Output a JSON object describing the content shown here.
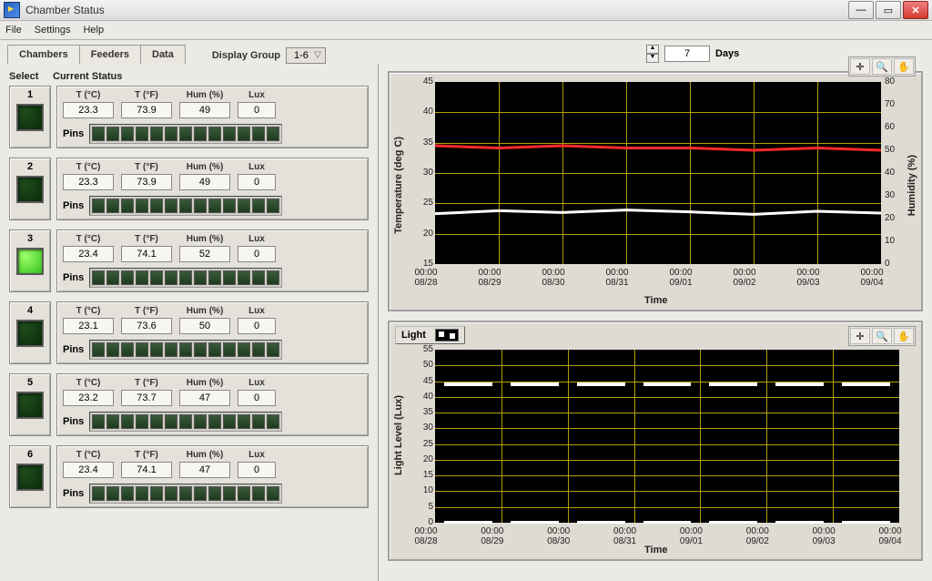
{
  "window": {
    "title": "Chamber Status"
  },
  "menu": {
    "file": "File",
    "settings": "Settings",
    "help": "Help"
  },
  "tabs": {
    "chambers": "Chambers",
    "feeders": "Feeders",
    "data": "Data"
  },
  "display_group": {
    "label": "Display Group",
    "value": "1-6"
  },
  "days": {
    "value": "7",
    "label": "Days"
  },
  "columns": {
    "select": "Select",
    "current": "Current Status",
    "tc": "T (°C)",
    "tf": "T (°F)",
    "hum": "Hum (%)",
    "lux": "Lux",
    "pins": "Pins"
  },
  "chambers": [
    {
      "n": "1",
      "sel": false,
      "tc": "23.3",
      "tf": "73.9",
      "hum": "49",
      "lux": "0"
    },
    {
      "n": "2",
      "sel": false,
      "tc": "23.3",
      "tf": "73.9",
      "hum": "49",
      "lux": "0"
    },
    {
      "n": "3",
      "sel": true,
      "tc": "23.4",
      "tf": "74.1",
      "hum": "52",
      "lux": "0"
    },
    {
      "n": "4",
      "sel": false,
      "tc": "23.1",
      "tf": "73.6",
      "hum": "50",
      "lux": "0"
    },
    {
      "n": "5",
      "sel": false,
      "tc": "23.2",
      "tf": "73.7",
      "hum": "47",
      "lux": "0"
    },
    {
      "n": "6",
      "sel": false,
      "tc": "23.4",
      "tf": "74.1",
      "hum": "47",
      "lux": "0"
    }
  ],
  "chart_data": [
    {
      "type": "line",
      "title": "",
      "xlabel": "Time",
      "ylabel_left": "Temperature (deg C)",
      "ylabel_right": "Humidity (%)",
      "ylim_left": [
        15,
        45
      ],
      "ylim_right": [
        0,
        80
      ],
      "y_ticks_left": [
        15,
        20,
        25,
        30,
        35,
        40,
        45
      ],
      "y_ticks_right": [
        0,
        10,
        20,
        30,
        40,
        50,
        60,
        70,
        80
      ],
      "x_ticks": [
        "00:00\n08/28",
        "00:00\n08/29",
        "00:00\n08/30",
        "00:00\n08/31",
        "00:00\n09/01",
        "00:00\n09/02",
        "00:00\n09/03",
        "00:00\n09/04"
      ],
      "x": [
        0,
        1,
        2,
        3,
        4,
        5,
        6,
        7
      ],
      "series": [
        {
          "name": "Temperature",
          "axis": "left",
          "color": "#ffffff",
          "values": [
            23.3,
            23.8,
            23.5,
            23.9,
            23.6,
            23.2,
            23.7,
            23.4
          ]
        },
        {
          "name": "Humidity",
          "axis": "right",
          "color": "#ff2a2a",
          "values": [
            52,
            51,
            52,
            51,
            51,
            50,
            51,
            50
          ]
        }
      ]
    },
    {
      "type": "line",
      "title": "Light",
      "xlabel": "Time",
      "ylabel_left": "Light Level (Lux)",
      "ylim_left": [
        0,
        55
      ],
      "y_ticks_left": [
        0,
        5,
        10,
        15,
        20,
        25,
        30,
        35,
        40,
        45,
        50,
        55
      ],
      "x_ticks": [
        "00:00\n08/28",
        "00:00\n08/29",
        "00:00\n08/30",
        "00:00\n08/31",
        "00:00\n09/01",
        "00:00\n09/02",
        "00:00\n09/03",
        "00:00\n09/04"
      ],
      "x": [
        0,
        1,
        2,
        3,
        4,
        5,
        6,
        7
      ],
      "series": [
        {
          "name": "Light",
          "axis": "left",
          "color": "#ffffff",
          "on_value": 44,
          "off_value": 0,
          "pattern": "square-wave-daily"
        }
      ]
    }
  ]
}
